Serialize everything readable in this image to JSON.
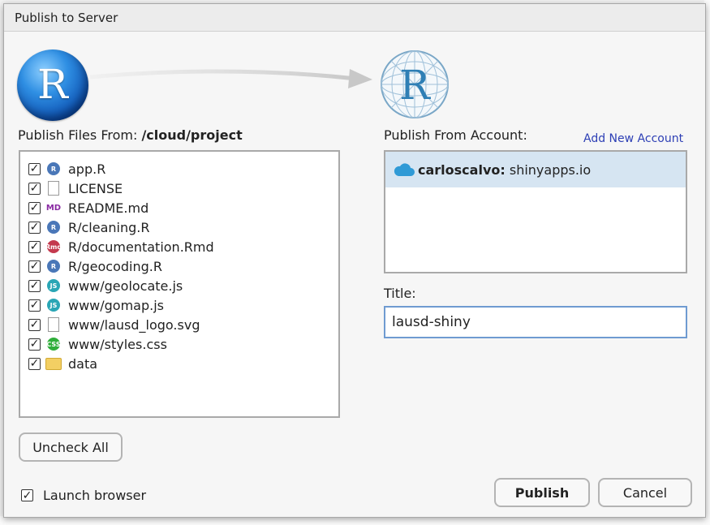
{
  "dialog": {
    "title": "Publish to Server"
  },
  "files": {
    "label": "Publish Files From:",
    "path": "/cloud/project",
    "items": [
      {
        "name": "app.R",
        "icon": "r-file-icon",
        "checked": true
      },
      {
        "name": "LICENSE",
        "icon": "text-file-icon",
        "checked": true
      },
      {
        "name": "README.md",
        "icon": "markdown-file-icon",
        "checked": true
      },
      {
        "name": "R/cleaning.R",
        "icon": "r-file-icon",
        "checked": true
      },
      {
        "name": "R/documentation.Rmd",
        "icon": "rmarkdown-file-icon",
        "checked": true
      },
      {
        "name": "R/geocoding.R",
        "icon": "r-file-icon",
        "checked": true
      },
      {
        "name": "www/geolocate.js",
        "icon": "js-file-icon",
        "checked": true
      },
      {
        "name": "www/gomap.js",
        "icon": "js-file-icon",
        "checked": true
      },
      {
        "name": "www/lausd_logo.svg",
        "icon": "text-file-icon",
        "checked": true
      },
      {
        "name": "www/styles.css",
        "icon": "css-file-icon",
        "checked": true
      },
      {
        "name": "data",
        "icon": "folder-icon",
        "checked": true
      }
    ],
    "uncheck_all_label": "Uncheck All"
  },
  "account": {
    "label": "Publish From Account:",
    "add_link": "Add New Account",
    "selected_user": "carloscalvo:",
    "selected_server": "shinyapps.io"
  },
  "title_field": {
    "label": "Title:",
    "value": "lausd-shiny"
  },
  "launch_browser": {
    "label": "Launch browser",
    "checked": true
  },
  "buttons": {
    "publish": "Publish",
    "cancel": "Cancel"
  },
  "colors": {
    "link": "#2d3fb5",
    "selection": "#d6e5f2",
    "r_icon": "#4a77b8",
    "js_icon": "#2aa6b5",
    "css_icon": "#2fae3a",
    "rmd_icon": "#c4394e"
  }
}
